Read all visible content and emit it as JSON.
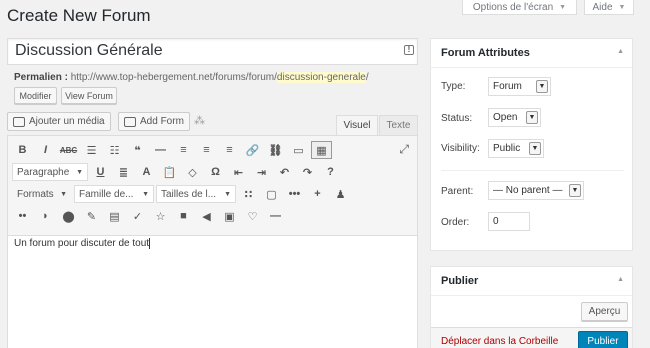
{
  "header": {
    "title": "Create New Forum",
    "screen_options": "Options de l'écran",
    "help": "Aide"
  },
  "post": {
    "title": "Discussion Générale",
    "permalink_label": "Permalien :",
    "permalink_base": "http://www.top-hebergement.net/forums/forum/",
    "permalink_slug": "discussion-generale",
    "permalink_end": "/",
    "edit_button": "Modifier",
    "view_button": "View Forum"
  },
  "editor": {
    "add_media": "Ajouter un média",
    "add_form": "Add Form",
    "tab_visual": "Visuel",
    "tab_text": "Texte",
    "format_select": "Paragraphe",
    "formats_menu": "Formats",
    "font_family": "Famille de...",
    "font_size": "Tailles de l...",
    "content": "Un forum pour discuter de tout",
    "row1_icons": [
      "bold-icon",
      "italic-icon",
      "strikethrough-icon",
      "bullet-list-icon",
      "numbered-list-icon",
      "blockquote-icon",
      "horizontal-rule-icon",
      "align-left-icon",
      "align-center-icon",
      "align-right-icon",
      "link-icon",
      "unlink-icon",
      "read-more-icon",
      "toolbar-toggle-icon"
    ],
    "row1_glyphs": [
      "B",
      "I",
      "ABC",
      "☰",
      "☷",
      "❝",
      "—",
      "≡",
      "≡",
      "≡",
      "🔗",
      "⛓",
      "▭",
      "▦"
    ],
    "row2_icons": [
      "underline-icon",
      "justify-icon",
      "text-color-icon",
      "paste-text-icon",
      "clear-formatting-icon",
      "special-character-icon",
      "outdent-icon",
      "indent-icon",
      "undo-icon",
      "redo-icon",
      "help-icon"
    ],
    "row2_glyphs": [
      "U",
      "≣",
      "A",
      "📋",
      "◇",
      "Ω",
      "⇤",
      "⇥",
      "↶",
      "↷",
      "?"
    ],
    "row3_icons": [
      "shortcode-icon",
      "box-icon",
      "more-icon",
      "plus-icon",
      "user-icon"
    ],
    "row3_glyphs": [
      "∷",
      "▢",
      "•••",
      "+",
      "♟"
    ],
    "row4_icons": [
      "dots-icon",
      "rss-icon",
      "map-pin-icon",
      "pencil-icon",
      "table-icon",
      "check-icon",
      "star-icon",
      "video-icon",
      "audio-icon",
      "image-icon",
      "heart-icon",
      "divider-icon"
    ],
    "row4_glyphs": [
      "••",
      "◗",
      "⬤",
      "✎",
      "▤",
      "✓",
      "☆",
      "■",
      "◀",
      "▣",
      "♡",
      "—"
    ]
  },
  "attributes": {
    "heading": "Forum Attributes",
    "type_label": "Type:",
    "type_value": "Forum",
    "status_label": "Status:",
    "status_value": "Open",
    "visibility_label": "Visibility:",
    "visibility_value": "Public",
    "parent_label": "Parent:",
    "parent_value": "— No parent —",
    "order_label": "Order:",
    "order_value": "0"
  },
  "publish": {
    "heading": "Publier",
    "preview": "Aperçu",
    "trash": "Déplacer dans la Corbeille",
    "publish": "Publier"
  }
}
